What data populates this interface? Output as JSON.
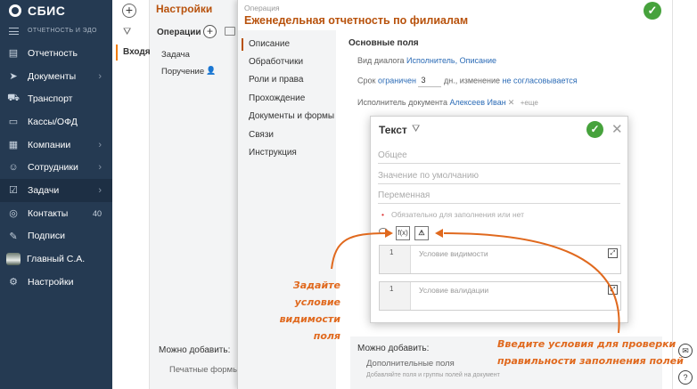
{
  "nav": {
    "brand": "СБИС",
    "subtitle": "ОТЧЕТНОСТЬ И ЭДО",
    "items": [
      {
        "label": "Отчетность",
        "icon": "report-icon"
      },
      {
        "label": "Документы",
        "icon": "send-icon",
        "chevron": true
      },
      {
        "label": "Транспорт",
        "icon": "truck-icon"
      },
      {
        "label": "Кассы/ОФД",
        "icon": "cashbox-icon"
      },
      {
        "label": "Компании",
        "icon": "companies-icon",
        "chevron": true
      },
      {
        "label": "Сотрудники",
        "icon": "employees-icon",
        "chevron": true
      },
      {
        "label": "Задачи",
        "icon": "tasks-icon",
        "chevron": true,
        "active": true
      },
      {
        "label": "Контакты",
        "icon": "contacts-icon",
        "count": "40"
      },
      {
        "label": "Подписи",
        "icon": "signature-icon"
      },
      {
        "label": "Главный С.А.",
        "icon": "avatar"
      },
      {
        "label": "Настройки",
        "icon": "gear-icon"
      }
    ]
  },
  "col1": {
    "incoming": "Входящ"
  },
  "settings": {
    "title": "Настройки",
    "operations_label": "Операции",
    "items": [
      "Задача",
      "Поручение"
    ],
    "can_add": "Можно добавить:",
    "print_forms": "Печатные формы"
  },
  "operation": {
    "label": "Операция",
    "title": "Еженедельная отчетность по филиалам",
    "tabs": [
      "Описание",
      "Обработчики",
      "Роли и права",
      "Прохождение",
      "Документы и формы",
      "Связи",
      "Инструкция"
    ],
    "section_title": "Основные поля",
    "dialog_view": {
      "prefix": "Вид диалога",
      "value": "Исполнитель, Описание"
    },
    "term": {
      "prefix": "Срок",
      "link": "ограничен",
      "days": "3",
      "suffix1": "дн., изменение",
      "link2": "не согласовывается"
    },
    "executor": {
      "prefix": "Исполнитель документа",
      "value": "Алексеев Иван",
      "more": "+еще"
    },
    "bottom": {
      "title": "Можно добавить:",
      "sub": "Дополнительные поля",
      "hint": "Добавляйте поля и группы полей на документ"
    }
  },
  "dialog": {
    "title": "Текст",
    "fields": [
      "Общее",
      "Значение по умолчанию",
      "Переменная"
    ],
    "required": "Обязательно для заполнения или нет",
    "fx_label": "f(x)",
    "warn_label": "⚠",
    "visibility": {
      "line": "1",
      "placeholder": "Условие видимости"
    },
    "validation": {
      "line": "1",
      "placeholder": "Условие валидации"
    }
  },
  "annotations": {
    "left_line1": "Задайте условие",
    "left_line2": "видимости поля",
    "right_line1": "Введите условия для проверки",
    "right_line2": "правильности заполнения полей"
  },
  "colors": {
    "accent": "#b8520c",
    "arrow": "#e0691e",
    "nav": "#253a52",
    "ok": "#46a23c",
    "link": "#2b6bb6"
  }
}
